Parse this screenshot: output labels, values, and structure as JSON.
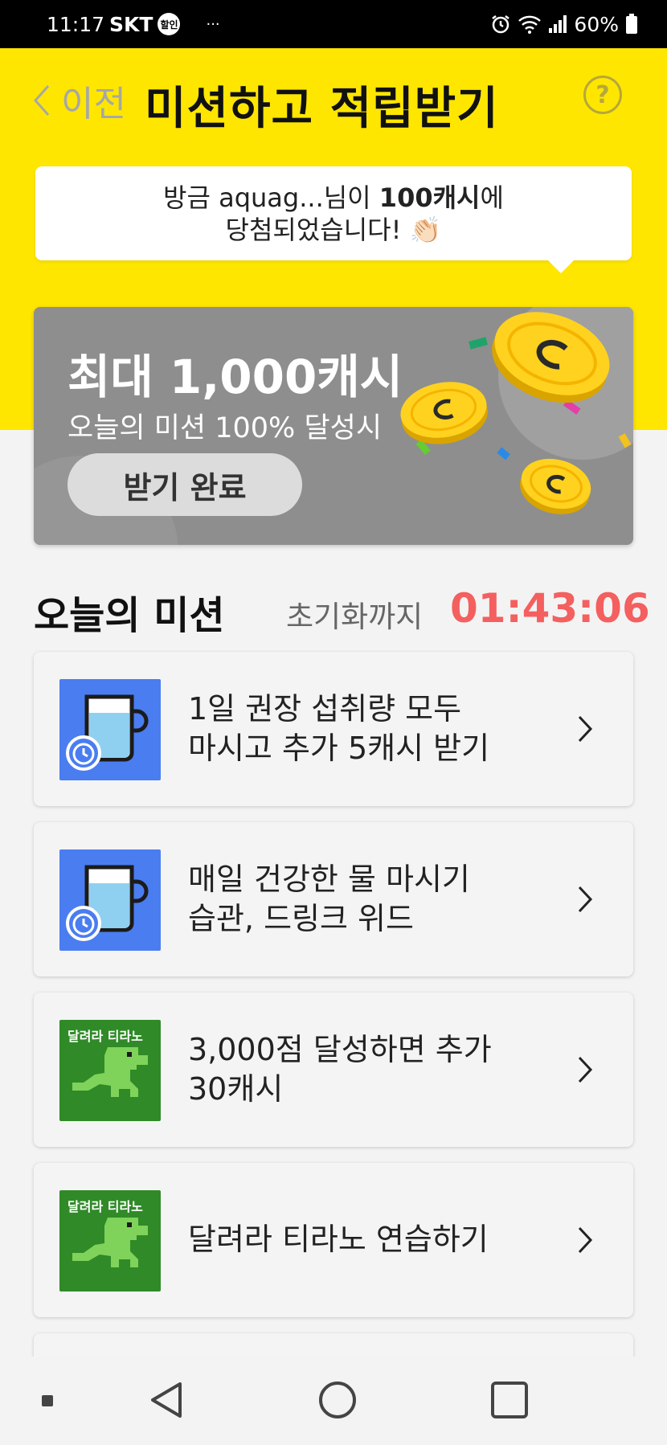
{
  "status_bar": {
    "time": "11:17",
    "carrier": "SKT",
    "carrier_badge": "할인",
    "more": "···",
    "battery": "60%"
  },
  "header": {
    "back_label": "이전",
    "title": "미션하고 적립받기",
    "help_symbol": "?"
  },
  "notice": {
    "prefix": "방금 aquag...님이 ",
    "highlight": "100캐시",
    "suffix": "에",
    "line2": "당첨되었습니다! 👏🏻"
  },
  "banner": {
    "title": "최대 1,000캐시",
    "subtitle": "오늘의 미션 100% 달성시",
    "button_label": "받기 완료"
  },
  "missions_section": {
    "title": "오늘의 미션",
    "reset_label": "초기화까지",
    "reset_timer": "01:43:06"
  },
  "missions": [
    {
      "line1": "1일 권장 섭취량 모두",
      "line2": "마시고 추가 5캐시 받기",
      "thumb": "water-cup-icon"
    },
    {
      "line1": "매일 건강한 물 마시기",
      "line2": "습관, 드링크 위드",
      "thumb": "water-cup-icon"
    },
    {
      "line1": "3,000점 달성하면 추가",
      "line2": "30캐시",
      "thumb": "tyranno-game-icon",
      "thumb_text": "달려라 티라노"
    },
    {
      "line1": "달려라 티라노 연습하기",
      "line2": "",
      "thumb": "tyranno-game-icon",
      "thumb_text": "달려라 티라노"
    }
  ],
  "colors": {
    "header_yellow": "#ffe600",
    "timer_red": "#f45f5f",
    "banner_gray": "#8e8e8e",
    "water_blue": "#4a7df0",
    "game_green": "#2f8a27"
  }
}
